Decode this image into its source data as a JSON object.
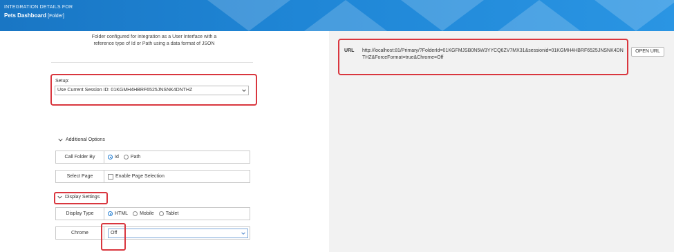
{
  "header": {
    "subtitle": "INTEGRATION DETAILS FOR",
    "title": "Pets Dashboard",
    "title_suffix": "[Folder]"
  },
  "description": {
    "line1": "Folder configured for integration as a User Interface with a",
    "line2": "reference type of Id or Path using a data format of JSON"
  },
  "setup": {
    "label": "Setup:",
    "selected_value": "Use Current Session ID: 01KGMH4HBRF6525JNSNK4DNTHZ"
  },
  "additional_options": {
    "toggle_label": "Additional Options",
    "call_folder_by": {
      "label": "Call Folder By",
      "options": [
        "Id",
        "Path"
      ],
      "selected": "Id"
    },
    "select_page": {
      "label": "Select Page",
      "checkbox_label": "Enable Page Selection",
      "checked": false
    }
  },
  "display_settings": {
    "toggle_label": "Display Settings",
    "display_type": {
      "label": "Display Type",
      "options": [
        "HTML",
        "Mobile",
        "Tablet"
      ],
      "selected": "HTML"
    },
    "chrome": {
      "label": "Chrome",
      "selected_value": "Off"
    }
  },
  "url_panel": {
    "label": "URL",
    "value": "http://localhost:81/Primary/?FolderId=01KGFMJSB0N5W3YYCQ6ZV7MX31&sessionid=01KGMH4HBRF6525JNSNK4DNTHZ&ForceFormat=true&Chrome=Off",
    "open_button": "OPEN URL"
  },
  "colors": {
    "header_blue": "#1f86d6",
    "highlight_red": "#d9363e",
    "radio_blue": "#1e7bd1",
    "right_panel_bg": "#f2f2f2"
  }
}
